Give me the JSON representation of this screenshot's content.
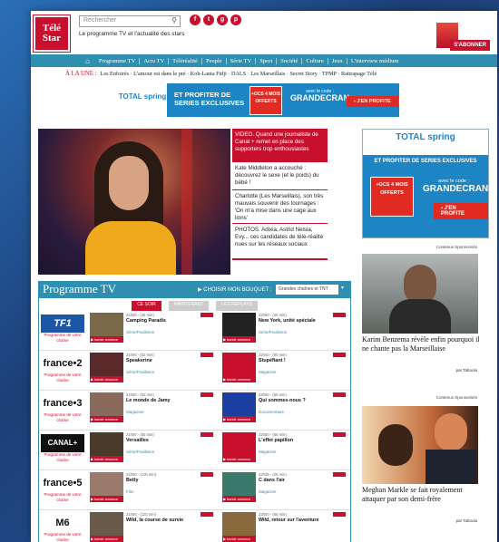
{
  "header": {
    "logo_text": "Télé Star",
    "search_placeholder": "Rechercher",
    "tagline": "Le programme TV et l'actualité des stars",
    "subscribe": "S'ABONNER"
  },
  "nav": [
    "Programme TV",
    "Actu TV",
    "Téléréalité",
    "People",
    "Série TV",
    "Sport",
    "Société",
    "Culture",
    "Jeux",
    "L'interview médium"
  ],
  "alaune": {
    "label": "À LA UNE :",
    "items": "Les Enfoirés · L'amour est dans le pré · Koh-Lanta Fidji · DALS · Les Marseillais · Secret Story · TPMP · Rattrapage Télé"
  },
  "ad_top": {
    "brand": "TOTAL spring",
    "line": "ET PROFITER DE SERIES EXCLUSIVES",
    "offer": "+OCS 4 MOIS OFFERTS",
    "code_label": "avec le code :",
    "code": "GRANDECRAN",
    "cta": "› J'EN PROFITE"
  },
  "news": [
    "VIDEO. Quand une journaliste de Canal + remet en place des supporters trop enthousiastes",
    "Kate Middleton a accouché : découvrez le sexe (et le poids) du bébé !",
    "Charlotte (Les Marseillais), son très mauvais souvenir des tournages : 'On m'a mise dans une cage aux lions'",
    "PHOTOS. Adixia, Astrid Nelsia, Evy... ces candidates de télé-réalité nues sur les réseaux sociaux"
  ],
  "ad_side": {
    "brand": "TOTAL spring",
    "line": "ET PROFITER DE SERIES EXCLUSIVES",
    "offer": "+OCS 4 MOIS OFFERTS",
    "code_label": "avec le code :",
    "code": "GRANDECRAN",
    "cta": "› J'EN PROFITE"
  },
  "sponsored": "Contenus Sponsorisés",
  "side_articles": [
    {
      "title": "Karim Benzema révèle enfin pourquoi il ne chante pas la Marseillaise",
      "by": "par Taboola"
    },
    {
      "title": "Meghan Markle se fait royalement attaquer par son demi-frère",
      "by": "par Taboola"
    }
  ],
  "programme": {
    "title": "Programme TV",
    "bouquet_label": "▶ CHOISIR MON BOUQUET :",
    "bouquet_value": "Grandes chaînes et TNT",
    "tabs": [
      "CE SOIR",
      "MAINTENANT",
      "LES REPLAYS"
    ],
    "channel_sub": "Programme de votre chaîne",
    "bande": "▶ bande annonce",
    "rows": [
      {
        "channel": "TF1",
        "p1": {
          "time": "21h00 - (45 min)",
          "title": "Camping Paradis",
          "genre": "Série/Feuilleton"
        },
        "p2": {
          "time": "22h50 - (45 min)",
          "title": "New York, unité spéciale",
          "genre": "Série/Feuilleton"
        }
      },
      {
        "channel": "france•2",
        "p1": {
          "time": "21h00 - (52 min)",
          "title": "Speakerine",
          "genre": "Série/Feuilleton"
        },
        "p2": {
          "time": "22h40 - (90 min)",
          "title": "Stupéfiant !",
          "genre": "Magazine"
        }
      },
      {
        "channel": "france•3",
        "p1": {
          "time": "21h00 - (52 min)",
          "title": "Le monde de Jamy",
          "genre": "Magazine"
        },
        "p2": {
          "time": "23h00 - (55 min)",
          "title": "Qui sommes-nous ?",
          "genre": "Documentaire"
        }
      },
      {
        "channel": "CANAL+",
        "p1": {
          "time": "21h00 - (55 min)",
          "title": "Versailles",
          "genre": "Série/Feuilleton"
        },
        "p2": {
          "time": "22h50 - (55 min)",
          "title": "L'effet papillon",
          "genre": "Magazine"
        }
      },
      {
        "channel": "france•5",
        "p1": {
          "time": "21h00 - (100 min)",
          "title": "Betty",
          "genre": "Film"
        },
        "p2": {
          "time": "22h35 - (25 min)",
          "title": "C dans l'air",
          "genre": "Magazine"
        }
      },
      {
        "channel": "M6",
        "p1": {
          "time": "21h00 - (120 min)",
          "title": "Wild, la course de survie",
          "genre": ""
        },
        "p2": {
          "time": "23h00 - (55 min)",
          "title": "Wild, retour sur l'aventure",
          "genre": ""
        }
      }
    ]
  }
}
